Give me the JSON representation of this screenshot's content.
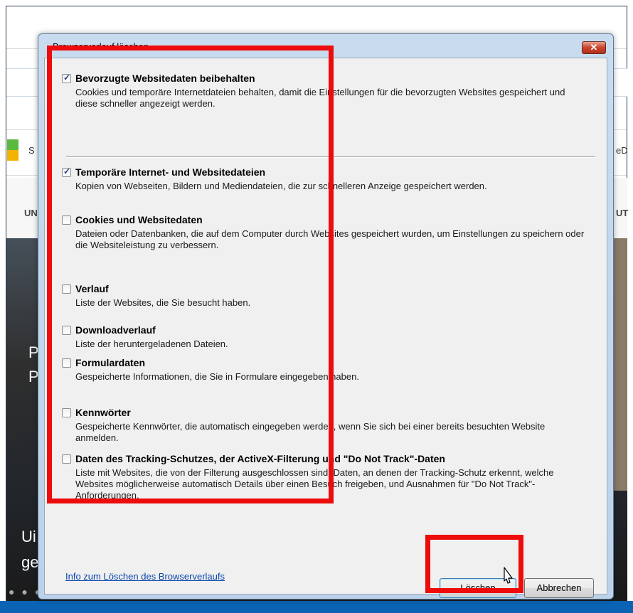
{
  "background": {
    "nav_left": "UN",
    "nav_right": "UT",
    "fav_left": "S",
    "fav_right": "eD",
    "hero_line1": "Pa",
    "hero_line2": "Pa",
    "bottom_line1": "Ui",
    "bottom_line2": "ge",
    "dots": "● ● ●"
  },
  "dialog": {
    "title": "Browserverlauf löschen",
    "close_glyph": "✕",
    "options": [
      {
        "label": "Bevorzugte Websitedaten beibehalten",
        "checked": true,
        "desc": "Cookies und temporäre Internetdateien behalten, damit die Einstellungen für die bevorzugten Websites gespeichert und diese schneller angezeigt werden."
      },
      {
        "label": "Temporäre Internet- und Websitedateien",
        "checked": true,
        "desc": "Kopien von Webseiten, Bildern und Mediendateien, die zur schnelleren Anzeige gespeichert werden."
      },
      {
        "label": "Cookies und Websitedaten",
        "checked": false,
        "desc": "Dateien oder Datenbanken, die auf dem Computer durch Websites gespeichert wurden, um Einstellungen zu speichern oder die Websiteleistung zu verbessern."
      },
      {
        "label": "Verlauf",
        "checked": false,
        "desc": "Liste der Websites, die Sie besucht haben."
      },
      {
        "label": "Downloadverlauf",
        "checked": false,
        "desc": "Liste der heruntergeladenen Dateien."
      },
      {
        "label": "Formulardaten",
        "checked": false,
        "desc": "Gespeicherte Informationen, die Sie in Formulare eingegeben haben."
      },
      {
        "label": "Kennwörter",
        "checked": false,
        "desc": "Gespeicherte Kennwörter, die automatisch eingegeben werden, wenn Sie sich bei einer bereits besuchten Website anmelden."
      },
      {
        "label": "Daten des Tracking-Schutzes, der ActiveX-Filterung und \"Do Not Track\"-Daten",
        "checked": false,
        "desc": "Liste mit Websites, die von der Filterung ausgeschlossen sind, Daten, an denen der Tracking-Schutz erkennt, welche Websites möglicherweise automatisch Details über einen Besuch freigeben, und Ausnahmen für \"Do Not Track\"-Anforderungen."
      }
    ],
    "info_link": "Info zum Löschen des Browserverlaufs",
    "delete_button": "Löschen",
    "cancel_button": "Abbrechen"
  },
  "colors": {
    "highlight": "#ee0b0b",
    "link": "#0645ad",
    "taskbar": "#0a63b4"
  }
}
